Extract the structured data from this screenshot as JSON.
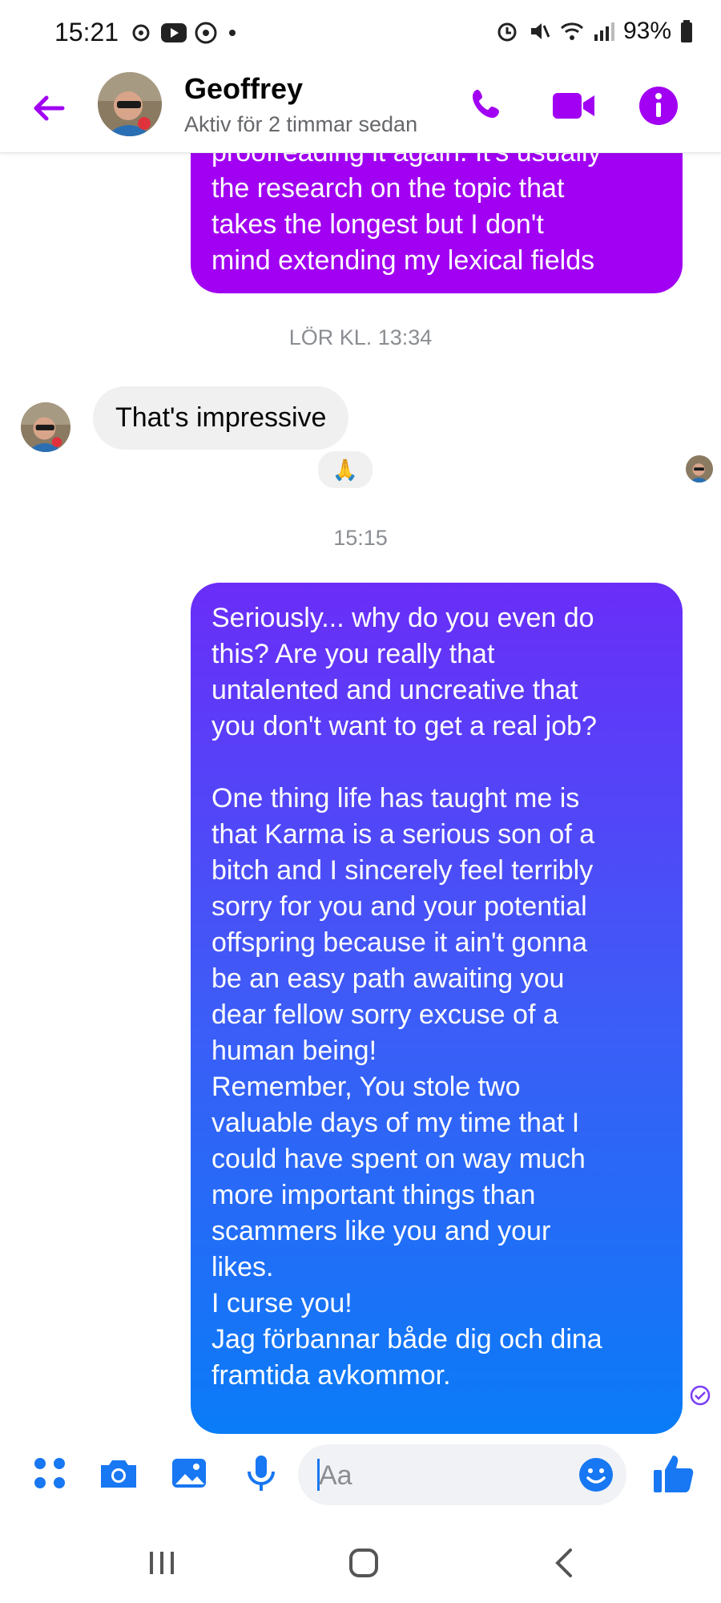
{
  "status_bar": {
    "time": "15:21",
    "left_icons": [
      "ai-assist-icon",
      "youtube-icon",
      "whatsapp-icon",
      "dot-icon"
    ],
    "right_icons": [
      "alarm-icon",
      "mute-icon",
      "wifi-icon",
      "signal-icon"
    ],
    "battery": "93%"
  },
  "header": {
    "name": "Geoffrey",
    "status": "Aktiv för 2 timmar sedan",
    "accent": "#a100f2"
  },
  "messages": {
    "top_outgoing": "proofreading it again. It's usually\nthe research on the topic that\ntakes the longest but I don't\nmind extending my lexical fields",
    "timestamp_1": "LÖR KL. 13:34",
    "incoming": "That's impressive",
    "reaction": "🙏",
    "timestamp_2": "15:15",
    "outgoing_long": "Seriously... why do you even do\nthis? Are you really that\nuntalented and uncreative that\nyou don't want to get a real job?\n\nOne thing life has taught me is\nthat Karma is a serious son of a\nbitch and I sincerely feel terribly\nsorry for you and your potential\noffspring because it ain't gonna\nbe an easy path awaiting you\ndear fellow sorry excuse of a\nhuman being!\nRemember, You stole two\nvaluable days of my time that I\ncould have spent on way much\nmore important things than\nscammers like you and your\nlikes.\nI curse you!\nJag förbannar både dig och dina\nframtida avkommor."
  },
  "composer": {
    "placeholder": "Aa",
    "icon_color": "#1877f2"
  }
}
